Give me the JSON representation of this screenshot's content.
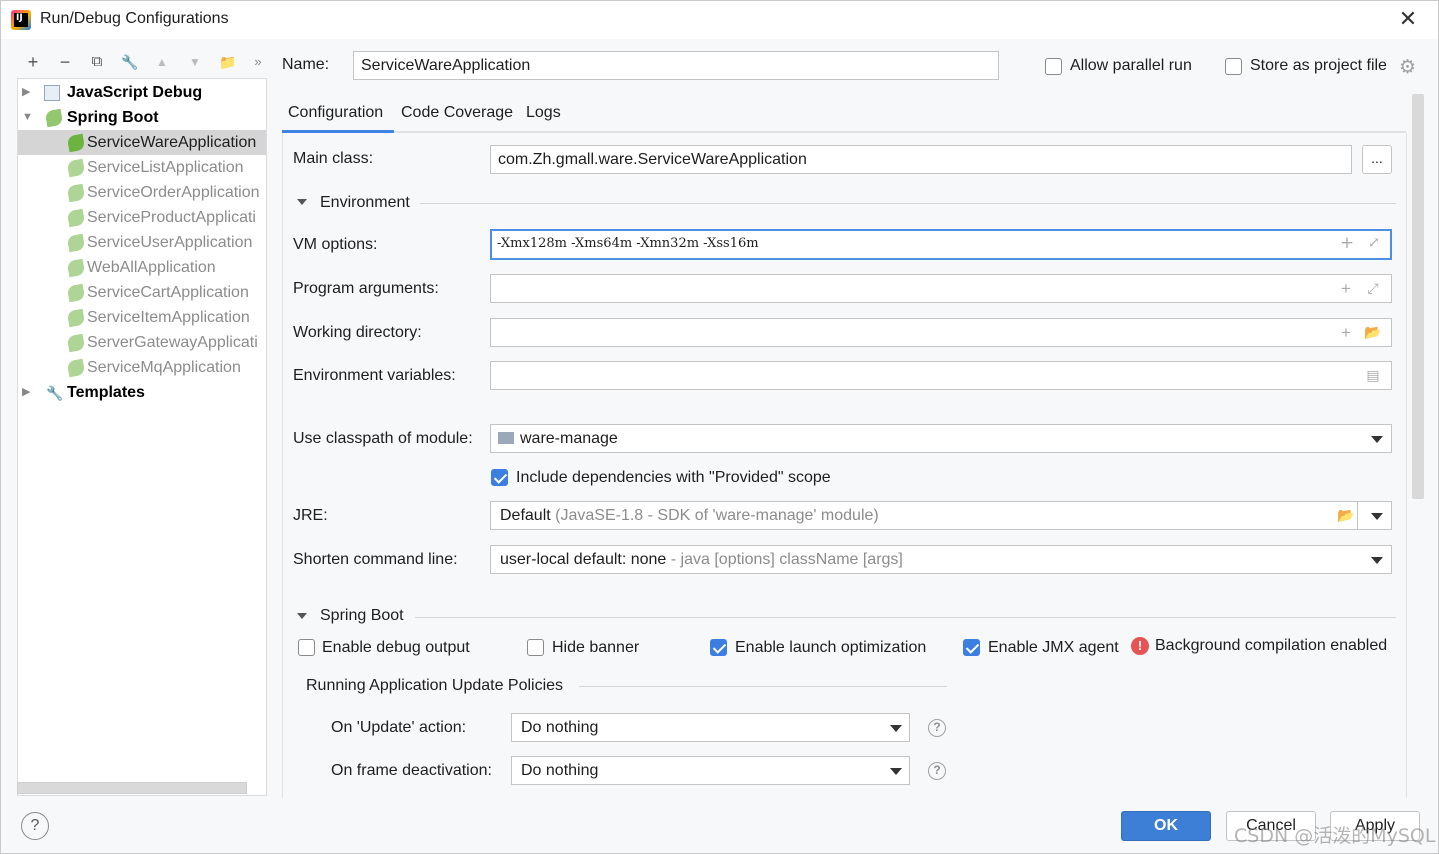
{
  "window": {
    "title": "Run/Debug Configurations"
  },
  "toolbar": {
    "add": "+",
    "remove": "−",
    "copy": "⧉",
    "wrench": "🔧",
    "up": "▲",
    "down": "▼",
    "folder": "📁",
    "more": "»"
  },
  "tree": {
    "groups": [
      {
        "label": "JavaScript Debug"
      },
      {
        "label": "Spring Boot"
      },
      {
        "label": "Templates"
      }
    ],
    "items": [
      "ServiceWareApplication",
      "ServiceListApplication",
      "ServiceOrderApplication",
      "ServiceProductApplicati",
      "ServiceUserApplication",
      "WebAllApplication",
      "ServiceCartApplication",
      "ServiceItemApplication",
      "ServerGatewayApplicati",
      "ServiceMqApplication"
    ]
  },
  "header": {
    "name_label": "Name:",
    "name_value": "ServiceWareApplication",
    "allow_parallel": "Allow parallel run",
    "store_project": "Store as project file"
  },
  "tabs": [
    "Configuration",
    "Code Coverage",
    "Logs"
  ],
  "form": {
    "main_class_label": "Main class:",
    "main_class_value": "com.Zh.gmall.ware.ServiceWareApplication",
    "browse": "...",
    "environment_section": "Environment",
    "vm_label": "VM options:",
    "vm_value": "-Xmx128m -Xms64m -Xmn32m -Xss16m",
    "program_args_label": "Program arguments:",
    "working_dir_label": "Working directory:",
    "env_vars_label": "Environment variables:",
    "classpath_label": "Use classpath of module:",
    "classpath_value": "ware-manage",
    "include_deps": "Include dependencies with \"Provided\" scope",
    "jre_label": "JRE:",
    "jre_value": "Default",
    "jre_detail": "(JavaSE-1.8 - SDK of 'ware-manage' module)",
    "shorten_label": "Shorten command line:",
    "shorten_value": "user-local default: none",
    "shorten_detail": "- java [options] className [args]"
  },
  "spring_boot": {
    "section": "Spring Boot",
    "debug_output": "Enable debug output",
    "hide_banner": "Hide banner",
    "launch_opt": "Enable launch optimization",
    "jmx": "Enable JMX agent",
    "bg_compile": "Background compilation enabled",
    "policies_title": "Running Application Update Policies",
    "update_label": "On 'Update' action:",
    "update_value": "Do nothing",
    "frame_label": "On frame deactivation:",
    "frame_value": "Do nothing"
  },
  "buttons": {
    "ok": "OK",
    "cancel": "Cancel",
    "apply": "Apply",
    "help": "?"
  },
  "watermark": "CSDN @活泼的MySQL",
  "colors": {
    "accent": "#3d7fd6",
    "focus": "#4d8fe0",
    "spring_green": "#6db33f",
    "error": "#e55353"
  }
}
